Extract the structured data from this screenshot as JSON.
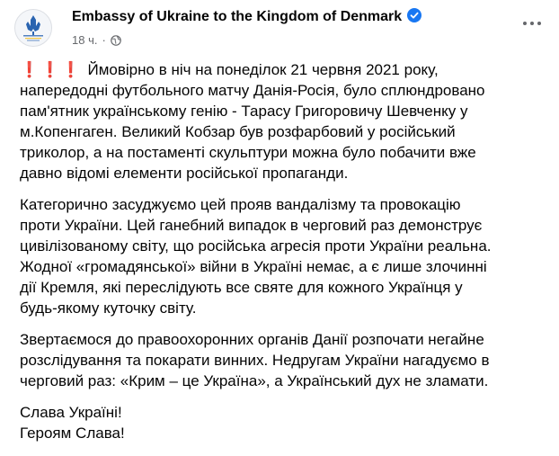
{
  "post": {
    "author": "Embassy of Ukraine to the Kingdom of Denmark",
    "avatar_text": "Ukrainian Embassy Copenhagen",
    "timestamp": "18 ч.",
    "separator": "·",
    "exclamation": "❗❗❗",
    "paragraphs": [
      {
        "lines": [
          "Ймовірно в ніч на понеділок 21 червня 2021 року,",
          "напередодні футбольного матчу Данія-Росія, було сплюндровано",
          "пам'ятник українському генію - Тарасу Григоровичу Шевченку у",
          "м.Копенгаген. Великий Кобзар був розфарбовий у російський",
          "триколор, а на постаменті скульптури можна було побачити вже",
          "давно відомі елементи російської пропаганди."
        ]
      },
      {
        "lines": [
          "Категорично засуджуємо цей прояв вандалізму та провокацію",
          "проти України. Цей ганебний випадок в черговий раз демонструє",
          "цивілізованому світу, що російська агресія проти України реальна.",
          "Жодної «громадянської» війни в Україні немає, а є лише злочинні",
          "дії Кремля, які переслідують все святе для кожного Українця у",
          "будь-якому куточку світу."
        ]
      },
      {
        "lines": [
          "Звертаємося до правоохоронних органів Данії розпочати негайне",
          "розслідування та покарати винних. Недругам України нагадуємо в",
          "черговий раз: «Крим – це Україна», а Український дух не зламати."
        ]
      },
      {
        "lines": [
          "Слава Україні!",
          "Героям Слава!"
        ]
      }
    ]
  }
}
